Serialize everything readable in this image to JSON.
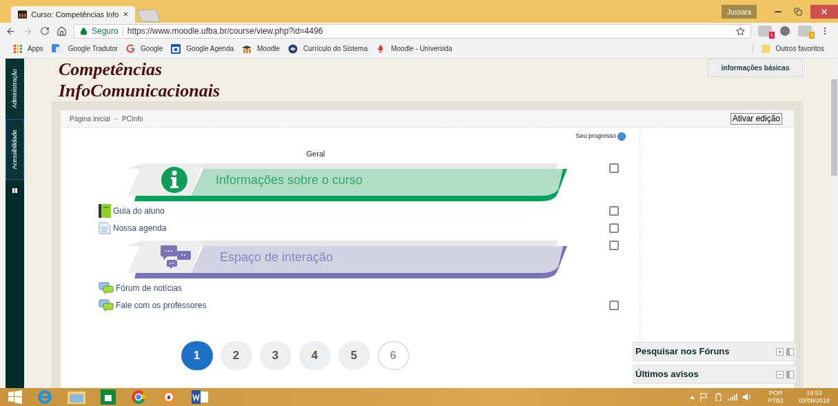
{
  "browser": {
    "tab_title": "Curso: Competências Info",
    "tab_close": "×",
    "user": "Jussara",
    "secure_label": "Seguro",
    "url": "https://www.moodle.ufba.br/course/view.php?id=4496",
    "extension_badges": [
      "1",
      "3"
    ],
    "bookmarks": [
      {
        "label": "Apps",
        "kind": "apps"
      },
      {
        "label": "Google Tradutor",
        "kind": "translate"
      },
      {
        "label": "Google",
        "kind": "google"
      },
      {
        "label": "Google Agenda",
        "kind": "calendar"
      },
      {
        "label": "Moodle",
        "kind": "moodle"
      },
      {
        "label": "Currículo do Sistema",
        "kind": "lattes"
      },
      {
        "label": "Moodle - Universida",
        "kind": "ufba"
      }
    ],
    "other_bookmarks": "Outros favoritos"
  },
  "side_tabs": [
    "Administração",
    "Acessibilidade"
  ],
  "course_title": [
    "Competências",
    "InfoComunicacionais"
  ],
  "basic_info_button": "informações básicas",
  "breadcrumb": [
    "Página inicial",
    "PCInfo"
  ],
  "breadcrumb_separator": "→",
  "edit_button": "Ativar edição",
  "progress_label": "Seu progresso",
  "section_heading": "Geral",
  "items": [
    {
      "kind": "info",
      "title": "Informações sobre o curso",
      "checked": false
    },
    {
      "kind": "book",
      "label": "Guia do aluno",
      "checked": false
    },
    {
      "kind": "page",
      "label": "Nossa agenda",
      "checked": false
    },
    {
      "kind": "chat",
      "title": "Espaço de interação",
      "checked": false
    },
    {
      "kind": "forum",
      "label": "Fórum de notícias"
    },
    {
      "kind": "forum",
      "label": "Fale com os professores",
      "checked": false
    }
  ],
  "pagination": [
    {
      "label": "1",
      "selected": true,
      "disabled": false
    },
    {
      "label": "2",
      "selected": false,
      "disabled": false
    },
    {
      "label": "3",
      "selected": false,
      "disabled": false
    },
    {
      "label": "4",
      "selected": false,
      "disabled": false
    },
    {
      "label": "5",
      "selected": false,
      "disabled": false
    },
    {
      "label": "6",
      "selected": false,
      "disabled": true
    }
  ],
  "blocks": [
    {
      "title": "Pesquisar nos Fóruns",
      "expanded": false
    },
    {
      "title": "Últimos avisos",
      "expanded": true
    }
  ],
  "taskbar": {
    "language": "POR",
    "layout": "PTB2",
    "time": "19:53",
    "date": "02/08/2018"
  }
}
